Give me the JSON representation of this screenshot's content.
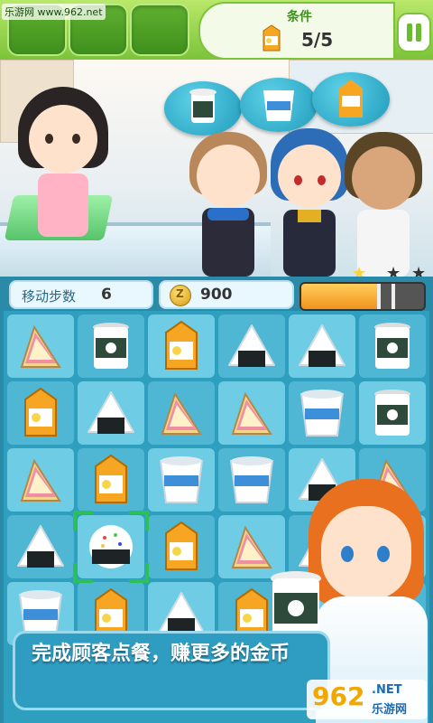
{
  "watermark": "乐游网 www.962.net",
  "condition": {
    "title": "条件",
    "progress": "5/5",
    "icon": "milk-carton-icon"
  },
  "stats": {
    "moves_label": "移动步数",
    "moves_value": "6",
    "coins_value": "900",
    "coin_symbol": "Z",
    "stars_earned": 1,
    "stars_total": 3,
    "progress_fraction": 0.62
  },
  "customers": [
    {
      "name": "customer-1",
      "order": "coffee-cup-icon"
    },
    {
      "name": "customer-2",
      "order": "instant-noodle-icon"
    },
    {
      "name": "customer-3",
      "order": "milk-carton-icon"
    }
  ],
  "board": [
    [
      "sandwich",
      "coffee",
      "milk",
      "onigiri",
      "onigiri",
      "coffee"
    ],
    [
      "milk",
      "onigiri",
      "sandwich",
      "sandwich",
      "noodle",
      "coffee"
    ],
    [
      "sandwich",
      "milk",
      "noodle",
      "noodle",
      "onigiri",
      "sandwich"
    ],
    [
      "onigiri",
      "onigiri-sprinkle",
      "milk",
      "sandwich",
      "onigiri",
      "milk"
    ],
    [
      "noodle",
      "milk",
      "onigiri",
      "milk",
      "",
      ""
    ]
  ],
  "selected_cell": {
    "row": 3,
    "col": 1
  },
  "tip": "完成顾客点餐，赚更多的金币",
  "logo": {
    "num": "962",
    "net": ".NET",
    "cn": "乐游网"
  },
  "colors": {
    "accent_green": "#7cc33a",
    "board_blue": "#2f9fbf"
  }
}
